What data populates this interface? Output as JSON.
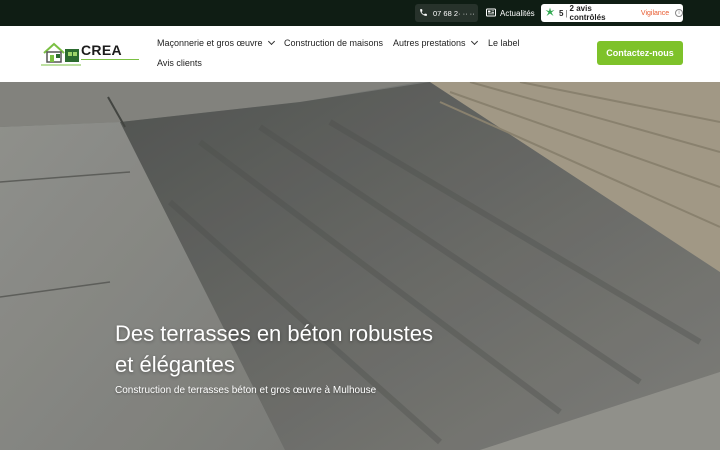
{
  "topbar": {
    "phone": "07 68 2· ·· ··",
    "news_label": "Actualités",
    "reviews": {
      "score": "5",
      "separator": "|",
      "count": "2 avis contrôlés",
      "vigilance": "Vigilance",
      "info_glyph": "i"
    }
  },
  "header": {
    "logo_text": "CREA",
    "nav": [
      {
        "label": "Maçonnerie et gros œuvre",
        "has_dropdown": true
      },
      {
        "label": "Construction de maisons",
        "has_dropdown": false
      },
      {
        "label": "Autres prestations",
        "has_dropdown": true
      },
      {
        "label": "Le label",
        "has_dropdown": false
      },
      {
        "label": "Avis clients",
        "has_dropdown": false
      }
    ],
    "cta_label": "Contactez-nous"
  },
  "hero": {
    "title_line1": "Des terrasses en béton robustes",
    "title_line2": "et élégantes",
    "subtitle": "Construction de terrasses béton et gros œuvre à Mulhouse"
  },
  "colors": {
    "topbar_bg": "#0f1d14",
    "accent_green": "#7ec22a",
    "vigilance_orange": "#e85a2e"
  }
}
